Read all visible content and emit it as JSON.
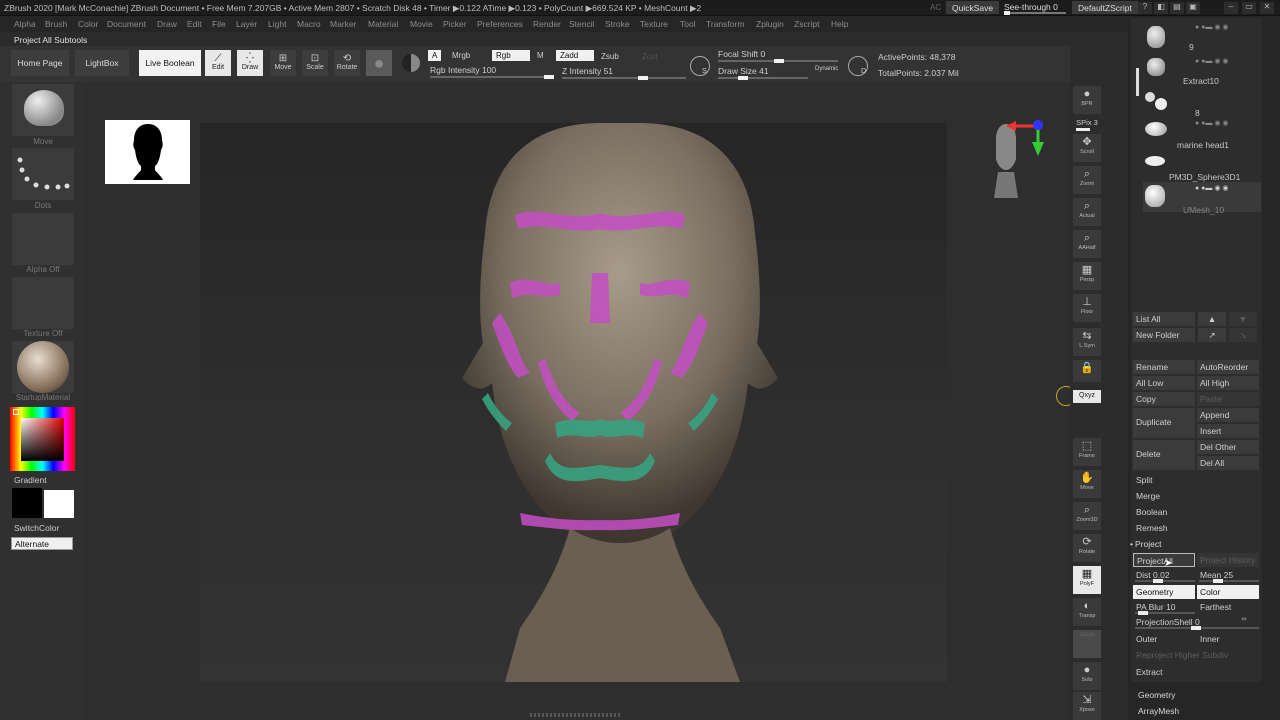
{
  "titlebar": {
    "text": "ZBrush 2020 [Mark McConachie]   ZBrush Document      • Free Mem 7.207GB • Active Mem 2807 • Scratch Disk 48 • Timer ▶0.122 ATime ▶0.123 • PolyCount ▶669.524 KP • MeshCount ▶2",
    "ac": "AC",
    "quicksave": "QuickSave",
    "see_through": "See-through  0",
    "script": "DefaultZScript",
    "icons": [
      "?",
      "◧",
      "▤",
      "▣",
      "–",
      "▭",
      "✕"
    ]
  },
  "menu": [
    "Alpha",
    "Brush",
    "Color",
    "Document",
    "Draw",
    "Edit",
    "File",
    "Layer",
    "Light",
    "Macro",
    "Marker",
    "Material",
    "Movie",
    "Picker",
    "Preferences",
    "Render",
    "Stencil",
    "Stroke",
    "Texture",
    "Tool",
    "Transform",
    "Zplugin",
    "Zscript",
    "Help"
  ],
  "subtools_label": "Project All Subtools",
  "toolbar": {
    "home": "Home Page",
    "lightbox": "LightBox",
    "live_boolean": "Live Boolean",
    "edit": "Edit",
    "draw": "Draw",
    "move": "Move",
    "scale": "Scale",
    "rotate": "Rotate",
    "a_label": "A",
    "mrgb": "Mrgb",
    "rgb": "Rgb",
    "m": "M",
    "zadd": "Zadd",
    "zsub": "Zsub",
    "zcut": "Zcut",
    "rgb_intensity": "Rgb Intensity 100",
    "rgb_intensity_value": 100,
    "z_intensity": "Z Intensity 51",
    "z_intensity_value": 51,
    "focal_shift": "Focal Shift 0",
    "focal_shift_value": 0,
    "draw_size": "Draw Size 41",
    "draw_size_value": 41,
    "dynamic": "Dynamic",
    "s_label": "S",
    "d_label": "D",
    "active_points": "ActivePoints: 48,378",
    "total_points": "TotalPoints: 2.037 Mil"
  },
  "leftshelf": {
    "brush": "Move",
    "stroke": "Dots",
    "alpha": "Alpha Off",
    "texture": "Texture Off",
    "material": "StartupMaterial",
    "gradient": "Gradient",
    "switchcolor": "SwitchColor",
    "alternate": "Alternate"
  },
  "rstrip": [
    {
      "label": "BPR",
      "glyph": "●"
    },
    {
      "label": "SPix 3",
      "glyph": ""
    },
    {
      "label": "Scroll",
      "glyph": "✥"
    },
    {
      "label": "Zoom",
      "glyph": "⌕"
    },
    {
      "label": "Actual",
      "glyph": "⌕"
    },
    {
      "label": "AAHalf",
      "glyph": "⌕"
    },
    {
      "label": "Persp",
      "glyph": "▦"
    },
    {
      "label": "Floor",
      "glyph": "⊥"
    },
    {
      "label": "L.Sym",
      "glyph": "⇆"
    },
    {
      "label": "",
      "glyph": "🔒"
    },
    {
      "label": "Qxyz",
      "glyph": ""
    },
    {
      "label": "Frame",
      "glyph": "⬚"
    },
    {
      "label": "Move",
      "glyph": "✋"
    },
    {
      "label": "Zoom3D",
      "glyph": "⌕"
    },
    {
      "label": "Rotate",
      "glyph": "⟳"
    },
    {
      "label": "PolyF",
      "glyph": "▦"
    },
    {
      "label": "Transp",
      "glyph": "◐"
    },
    {
      "label": "Ghost",
      "glyph": ""
    },
    {
      "label": "Solo",
      "glyph": "●"
    },
    {
      "label": "Xpose",
      "glyph": "⇲"
    }
  ],
  "subtools": [
    {
      "name": "9"
    },
    {
      "name": "Extract10"
    },
    {
      "name": "8"
    },
    {
      "name": "marine head1"
    },
    {
      "name": "PM3D_Sphere3D1"
    },
    {
      "name": "UMesh_10"
    }
  ],
  "subtool_panel": {
    "list_all": "List All",
    "new_folder": "New Folder",
    "rename": "Rename",
    "auto_reorder": "AutoReorder",
    "all_low": "All Low",
    "all_high": "All High",
    "copy": "Copy",
    "paste": "Paste",
    "duplicate": "Duplicate",
    "append": "Append",
    "insert": "Insert",
    "delete": "Delete",
    "del_other": "Del Other",
    "del_all": "Del All",
    "split": "Split",
    "merge": "Merge",
    "boolean": "Boolean",
    "remesh": "Remesh",
    "project": "Project",
    "project_all": "ProjectAll",
    "project_history": "Project History",
    "dist": "Dist 0.02",
    "mean": "Mean 25",
    "geometry_btn": "Geometry",
    "color_btn": "Color",
    "pa_blur": "PA Blur 10",
    "farthest": "Farthest",
    "projection_shell": "ProjectionShell 0",
    "outer": "Outer",
    "inner": "Inner",
    "reproject": "Reproject Higher Subdiv",
    "extract": "Extract",
    "geometry": "Geometry",
    "arraymesh": "ArrayMesh"
  }
}
